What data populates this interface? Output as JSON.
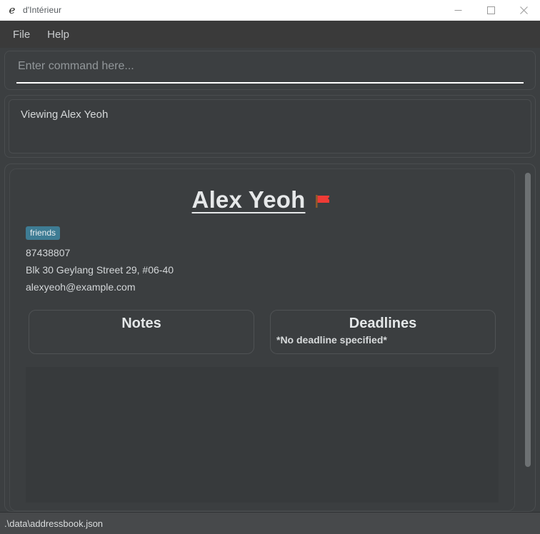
{
  "window": {
    "title": "d'Intérieur",
    "app_icon": "script-d-icon",
    "controls": {
      "minimize": "minimize-icon",
      "maximize": "maximize-icon",
      "close": "close-icon"
    }
  },
  "menubar": {
    "items": [
      {
        "label": "File"
      },
      {
        "label": "Help"
      }
    ]
  },
  "command": {
    "value": "",
    "placeholder": "Enter command here..."
  },
  "result": {
    "text": "Viewing Alex Yeoh"
  },
  "person": {
    "name": "Alex Yeoh",
    "flag": "triangular-flag",
    "tags": [
      "friends"
    ],
    "phone": "87438807",
    "address": "Blk 30 Geylang Street 29, #06-40",
    "email": "alexyeoh@example.com",
    "panels": {
      "notes": {
        "title": "Notes",
        "content": ""
      },
      "deadlines": {
        "title": "Deadlines",
        "content": "*No deadline specified*"
      }
    }
  },
  "statusbar": {
    "path": ".\\data\\addressbook.json"
  },
  "colors": {
    "window_background": "#3c3f41",
    "titlebar_background": "#ffffff",
    "menubar_background": "#3a3a3a",
    "card_background": "#3b3e40",
    "tag_background": "#3e7c94",
    "accent_underline": "#ffffff",
    "flag_red": "#ef3b36",
    "statusbar_background": "#47494b"
  }
}
